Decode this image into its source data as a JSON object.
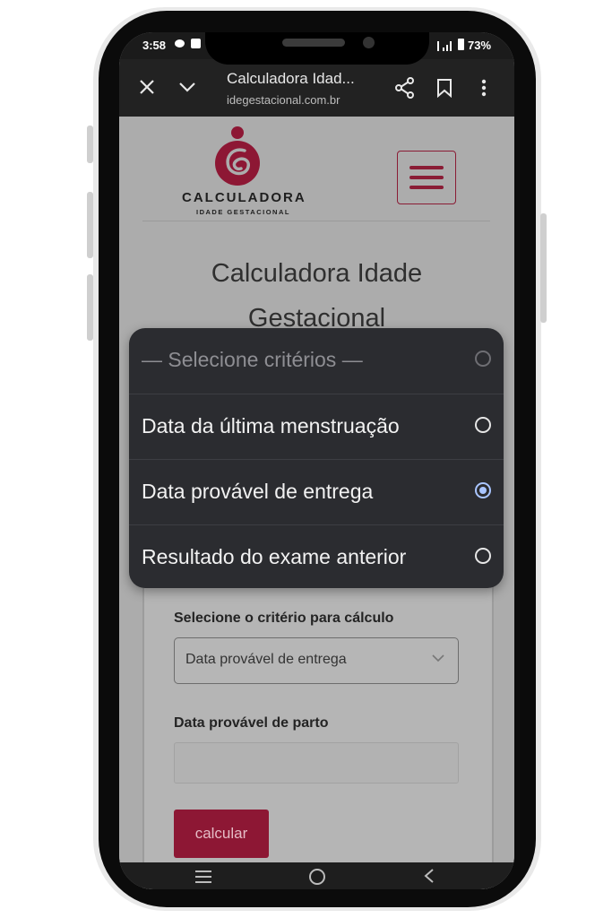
{
  "status_bar": {
    "time": "3:58",
    "battery": "73%"
  },
  "browser": {
    "title": "Calculadora Idad...",
    "url": "idegestacional.com.br"
  },
  "logo": {
    "name": "CALCULADORA",
    "tagline": "IDADE GESTACIONAL"
  },
  "page": {
    "title_line1": "Calculadora Idade",
    "title_line2": "Gestacional"
  },
  "form": {
    "criteria_label": "Selecione o critério para cálculo",
    "criteria_selected": "Data provável de entrega",
    "date_label": "Data provável de parto",
    "date_value": "",
    "calculate_label": "calcular"
  },
  "dropdown": {
    "options": [
      {
        "label": "— Selecione critérios —",
        "disabled": true,
        "selected": false
      },
      {
        "label": "Data da última menstruação",
        "disabled": false,
        "selected": false
      },
      {
        "label": "Data provável de entrega",
        "disabled": false,
        "selected": true
      },
      {
        "label": "Resultado do exame anterior",
        "disabled": false,
        "selected": false
      }
    ]
  },
  "colors": {
    "brand": "#8d1734",
    "popup_bg": "#2b2c30",
    "radio_selected": "#a9c5ff"
  },
  "icons": {
    "browser": [
      "close-icon",
      "chevron-down-icon",
      "share-icon",
      "bookmark-icon",
      "more-vert-icon"
    ],
    "nav": [
      "recents-icon",
      "home-icon",
      "back-icon"
    ]
  }
}
